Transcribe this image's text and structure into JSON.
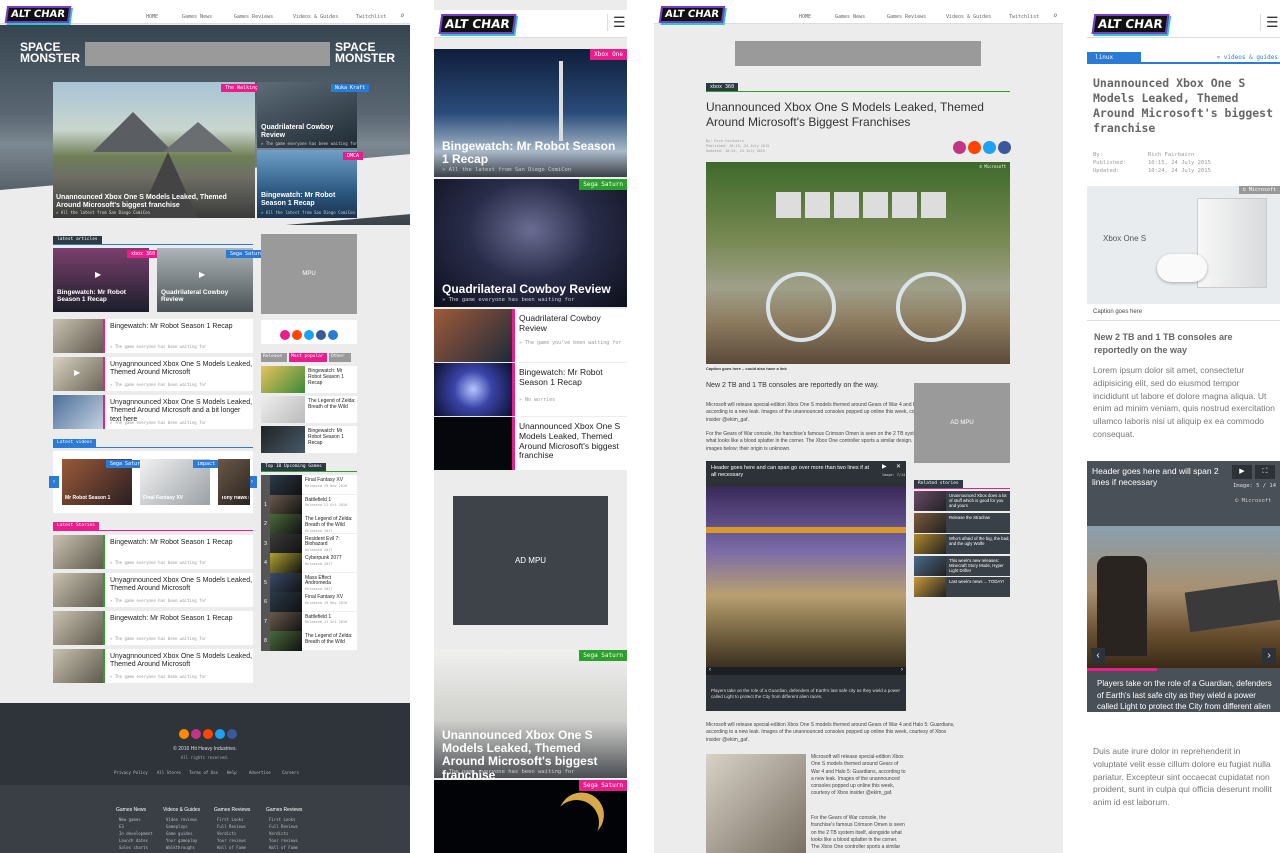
{
  "colors": {
    "pink": "#e91e8c",
    "green": "#2ca02c",
    "blue": "#2a7bd5",
    "dark": "#2c3a44",
    "adgrey": "#9a9a9a"
  },
  "logo": "ALT CHAR",
  "desktop": {
    "nav": [
      "HOME",
      "Games News",
      "Games Reviews",
      "Videos & Guides",
      "Twitchlist"
    ],
    "banner_left": "SPACE MONSTER",
    "banner_right": "SPACE MONSTER",
    "hero": {
      "tag": "The Walking Dead",
      "title": "Unannounced Xbox One S Models Leaked, Themed Around Microsoft's biggest franchise",
      "sub": "» All the latest from San Diego ComiCon"
    },
    "hero_side": [
      {
        "tag": "Nuka Kraft",
        "title": "Quadrilateral Cowboy Review",
        "sub": "» The game everyone has been waiting for"
      },
      {
        "tag": "DMCA",
        "title": "Bingewatch: Mr Robot Season 1 Recap",
        "sub": "» All the latest from San Diego ComiCon"
      }
    ],
    "latest_articles_label": "latest articles",
    "top_cards": [
      {
        "tag": "xbox 360",
        "title": "Bingewatch: Mr Robot Season 1 Recap",
        "sub": "» All the latest from San Diego ComiCon"
      },
      {
        "tag": "Sega Saturn",
        "title": "Quadrilateral Cowboy Review",
        "sub": "» The game everyone has been waiting for"
      }
    ],
    "list1": [
      {
        "title": "Bingewatch: Mr Robot Season 1 Recap",
        "sub": "» The game everyone has been waiting for"
      },
      {
        "title": "Unyagnnounced Xbox One S Models Leaked, Themed Around Microsoft",
        "sub": "» The game everyone has been waiting for"
      },
      {
        "title": "Unyagnnounced Xbox One S Models Leaked, Themed Around Microsoft and a bit longer text here",
        "sub": "» The game everyone has been waiting for"
      }
    ],
    "latest_videos_label": "Latest videos",
    "videos": [
      {
        "tag": "Sega Saturn",
        "title": "Mr Robot Season 1"
      },
      {
        "tag": "impact",
        "title": "Final Fantasy XV"
      },
      {
        "tag": "",
        "title": "Tony Hawk P"
      }
    ],
    "latest_stories_label": "Latest Stories",
    "list2": [
      {
        "title": "Bingewatch: Mr Robot Season 1 Recap",
        "sub": "» The game everyone has been waiting for"
      },
      {
        "title": "Unyagnnounced Xbox One S Models Leaked, Themed Around Microsoft",
        "sub": "» The game everyone has been waiting for"
      },
      {
        "title": "Bingewatch: Mr Robot Season 1 Recap",
        "sub": "» The game everyone has been waiting for"
      },
      {
        "title": "Unyagnnounced Xbox One S Models Leaked, Themed Around Microsoft",
        "sub": "» The game everyone has been waiting for"
      }
    ],
    "mpu": "MPU",
    "tabs": [
      "Release",
      "Most popular",
      "Other"
    ],
    "side_items": [
      {
        "title": "Bingewatch: Mr Robot Season 1 Recap"
      },
      {
        "title": "The Legend of Zelda: Breath of the Wild"
      },
      {
        "title": "Bingewatch: Mr Robot Season 1 Recap"
      }
    ],
    "top10_label": "Top 10 Upcoming Games",
    "top10": [
      {
        "n": "",
        "title": "Final Fantasy XV",
        "date": "Released 29 Nov 2016"
      },
      {
        "n": "1",
        "title": "Battlefield 1",
        "date": "Released 21 Oct 2016"
      },
      {
        "n": "2",
        "title": "The Legend of Zelda: Breath of the Wild",
        "date": "Released 2017"
      },
      {
        "n": "3",
        "title": "Resident Evil 7: Biohazard",
        "date": "Released 2017"
      },
      {
        "n": "4",
        "title": "Cyberpunk 2077",
        "date": "Released 2017"
      },
      {
        "n": "5",
        "title": "Mass Effect Andromeda",
        "date": "Released 2017"
      },
      {
        "n": "6",
        "title": "Final Fantasy XV",
        "date": "Released 29 Nov 2016"
      },
      {
        "n": "7",
        "title": "Battlefield 1",
        "date": "Released 21 Oct 2016"
      },
      {
        "n": "8",
        "title": "The Legend of Zelda: Breath of the Wild",
        "date": ""
      }
    ],
    "footer": {
      "copyright": "© 2016 Hit Heavy Industries.",
      "rights": "All rights reserved.",
      "links": [
        "Privacy Policy",
        "All Stores",
        "Terms of Use",
        "Help",
        "Advertise",
        "Careers"
      ],
      "cols": [
        {
          "head": "Games News",
          "items": [
            "New games",
            "E3",
            "In development",
            "Launch dates",
            "Sales charts"
          ]
        },
        {
          "head": "Videos & Guides",
          "items": [
            "Video reviews",
            "Gameplays",
            "Game guides",
            "Your gameplay",
            "Walkthroughs"
          ]
        },
        {
          "head": "Games Reviews",
          "items": [
            "First Looks",
            "Full Reviews",
            "Verdicts",
            "Your reviews",
            "Hall of Fame"
          ]
        },
        {
          "head": "Games Reviews",
          "items": [
            "First Looks",
            "Full Reviews",
            "Verdicts",
            "Your reviews",
            "Hall of Fame"
          ]
        }
      ]
    }
  },
  "mobile": {
    "features": [
      {
        "tag": "Xbox One",
        "title": "Bingewatch: Mr Robot Season 1 Recap",
        "sub": "» All the latest from San Diego ComiCon"
      },
      {
        "tag": "Sega Saturn",
        "title": "Quadrilateral Cowboy Review",
        "sub": "» The game everyone has been waiting for"
      }
    ],
    "rows": [
      {
        "title": "Quadrilateral Cowboy Review",
        "sub": "» The game you've been waiting for"
      },
      {
        "title": "Bingewatch: Mr Robot Season 1 Recap",
        "sub": "» No worries"
      },
      {
        "title": "Unannounced Xbox One S Models Leaked, Themed Around Microsoft's biggest franchise",
        "sub": ""
      }
    ],
    "ad": "AD MPU",
    "feature3": {
      "tag": "Sega Saturn",
      "title": "Unannounced Xbox One S Models Leaked, Themed Around Microsoft's biggest franchise",
      "sub": "» The game everyone has been waiting for"
    },
    "feature4": {
      "tag": "Sega Saturn"
    }
  },
  "article": {
    "tag": "xbox 360",
    "title": "Unannounced Xbox One S Models Leaked, Themed Around Microsoft's Biggest Franchises",
    "meta": [
      "By: Rich Fairbairn",
      "Published: 10:15, 24 July 2015",
      "Updated: 10:24, 24 July 2015"
    ],
    "caption": "Caption goes here – could also have a link",
    "credit": "© Microsoft",
    "lead": "New 2 TB and 1 TB consoles are reportedly on the way.",
    "p1": "Microsoft will release special-edition Xbox One S models themed around Gears of War 4 and Halo 5: Guardians, according to a new leak. Images of the unannounced consoles popped up online this week, courtesy of Xbox insider @ekim_gaf.",
    "p2": "For the Gears of War console, the franchise's famous Crimson Omen is seen on the 2 TB system itself, alongside what looks like a blood splatter in the corner. The Xbox One controller sports a similar design. Check out the images below; their origin is unknown.",
    "ad": "AD MPU",
    "gallery_header": "Header goes here and can span go over more than two lines if at all necessary",
    "gallery_count": "Image: 7/14",
    "gallery_caption": "Players take on the role of a Guardian, defenders of Earth's last safe city as they wield a power called Light to protect the City from different alien races.",
    "related_label": "Related stories",
    "related": [
      "Unannounced Xbox does a lot of stuff which is good for you and yours",
      "Release the Strachan",
      "Who's afraid of the big, the bad, and the ugly Wolfe",
      "This week's new releases: Minecraft Story Mode, Hyper Light Drifter",
      "Last week's news ... TODAY!"
    ],
    "p3": "Microsoft will release special-edition Xbox One S models themed around Gears of War 4 and Halo 5: Guardians, according to a new leak. Images of the unannounced consoles popped up online this week, courtesy of Xbox insider @ekim_gaf.",
    "p4": "Microsoft will release special-edition Xbox One S models themed around Gears of War 4 and Halo 5: Guardians, according to a new leak. Images of the unannounced consoles popped up online this week, courtesy of Xbox insider @ekim_gaf.",
    "p5": "For the Gears of War console, the franchise's famous Crimson Omen is seen on the 2 TB system itself, alongside what looks like a blood splatter in the corner. The Xbox One controller sports a similar"
  },
  "mobile_article": {
    "crumb_left": "linux",
    "crumb_right": "» videos & guides",
    "title": "Unannounced Xbox One S Models Leaked, Themed Around Microsoft's biggest franchise",
    "by_label": "By:",
    "by": "Rich Fairbairn",
    "pub_label": "Published:",
    "pub": "10:15, 24 July 2015",
    "upd_label": "Updated:",
    "upd": "10:24, 24 July 2015",
    "credit": "© Microsoft",
    "product": "Xbox One S",
    "caption": "Caption goes here",
    "lead": "New 2 TB and 1 TB consoles are reportedly on the way",
    "body1": "Lorem ipsum dolor sit amet, consectetur adipisicing elit, sed do eiusmod tempor incididunt ut labore et dolore magna aliqua. Ut enim ad minim veniam, quis nostrud exercitation ullamco laboris nisi ut aliquip ex ea commodo consequat.",
    "gallery_header": "Header goes here and will span 2 lines if necessary",
    "gallery_count": "Image: 5 / 14",
    "gallery_credit": "© Microsoft",
    "gallery_caption": "Players take on the role of a Guardian, defenders of Earth's last safe city as they wield a power called Light to protect the City from different alien races.",
    "body2": "Duis aute irure dolor in reprehenderit in voluptate velit esse cillum dolore eu fugiat nulla pariatur. Excepteur sint occaecat cupidatat non proident, sunt in culpa qui officia deserunt mollit anim id est laborum."
  }
}
